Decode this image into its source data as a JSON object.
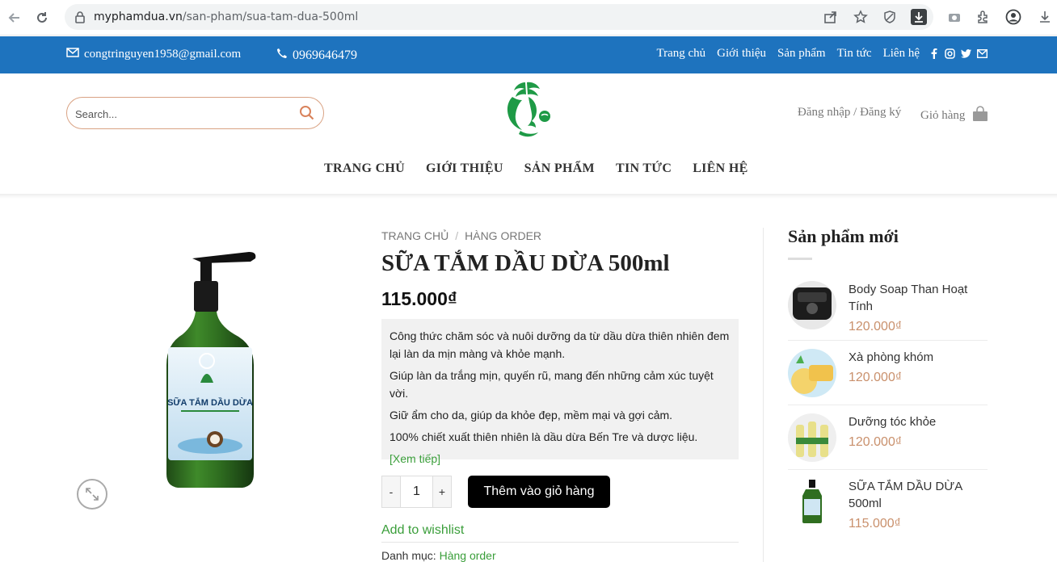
{
  "browser": {
    "url_host": "myphamdua.vn",
    "url_path": "/san-pham/sua-tam-dua-500ml"
  },
  "topbar": {
    "email": "congtringuyen1958@gmail.com",
    "phone": "0969646479",
    "nav": [
      "Trang chủ",
      "Giới thiệu",
      "Sản phẩm",
      "Tin tức",
      "Liên hệ"
    ],
    "social_icons": [
      "facebook-icon",
      "instagram-icon",
      "twitter-icon",
      "mail-icon"
    ],
    "bg_color": "#1e73be"
  },
  "header": {
    "search_placeholder": "Search...",
    "account_label": "Đăng nhập / Đăng ký",
    "cart_label": "Giỏ hàng",
    "nav": [
      "TRANG CHỦ",
      "GIỚI THIỆU",
      "SẢN PHẨM",
      "TIN TỨC",
      "LIÊN HỆ"
    ]
  },
  "product": {
    "breadcrumb": [
      "TRANG CHỦ",
      "HÀNG ORDER"
    ],
    "breadcrumb_sep": "/",
    "title": "SỮA TẮM DẦU DỪA 500ml",
    "price": "115.000₫",
    "label_line1": "SỮA TẮM DẦU DỪA",
    "description": [
      "Công thức chăm sóc và nuôi dưỡng da từ dầu dừa thiên nhiên đem lại làn da mịn màng và khỏe mạnh.",
      "Giúp làn da trắng mịn, quyến rũ, mang đến những cảm xúc tuyệt vời.",
      "Giữ ẩm cho da, giúp da khỏe đẹp, mềm mại và gợi cảm.",
      "100% chiết xuất thiên nhiên là dầu dừa Bến Tre và dược liệu."
    ],
    "read_more": "[Xem tiếp]",
    "qty_minus": "-",
    "qty_value": "1",
    "qty_plus": "+",
    "add_to_cart": "Thêm vào giỏ hàng",
    "wishlist": "Add to wishlist",
    "category_label": "Danh mục:",
    "category_value": "Hàng order"
  },
  "sidebar": {
    "title": "Sản phẩm mới",
    "items": [
      {
        "name": "Body Soap Than Hoạt Tính",
        "price": "120.000₫"
      },
      {
        "name": "Xà phòng khóm",
        "price": "120.000₫"
      },
      {
        "name": "Dưỡng tóc khỏe",
        "price": "120.000₫"
      },
      {
        "name": "SỮA TẮM DẦU DỪA 500ml",
        "price": "115.000₫"
      }
    ]
  },
  "colors": {
    "accent_green": "#3a9e3a",
    "price_tan": "#c9906c"
  }
}
